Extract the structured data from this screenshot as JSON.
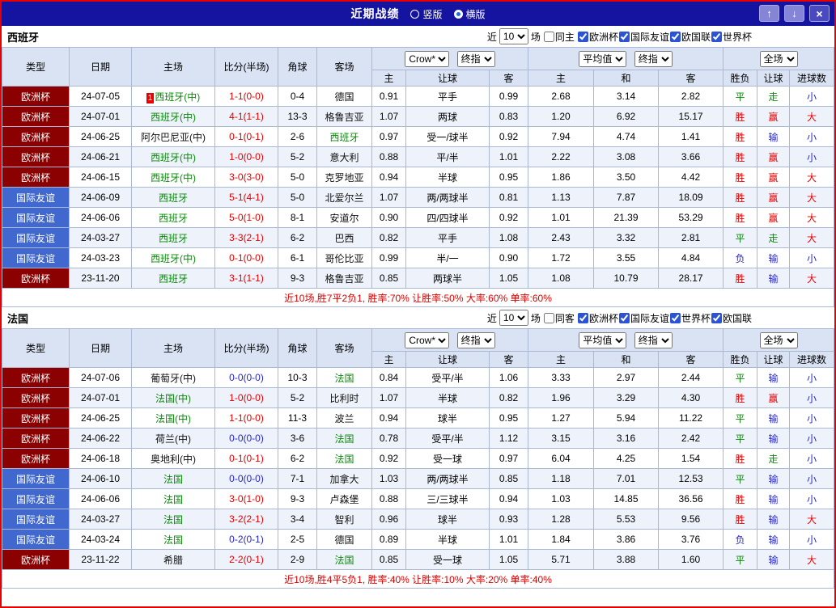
{
  "titlebar": {
    "title": "近期战绩",
    "layout_options": [
      {
        "label": "竖版",
        "selected": false
      },
      {
        "label": "横版",
        "selected": true
      }
    ],
    "buttons": {
      "up": "↑",
      "down": "↓",
      "close": "×"
    }
  },
  "colors": {
    "titlebar_bg": "#1414a0",
    "frame_border": "#e60000",
    "euro_cup_bg": "#8b0000",
    "friendly_bg": "#4168cf",
    "header_bg": "#d9e3f3",
    "win_red": "#e60000",
    "loss_blue": "#2626cc",
    "draw_green": "#0a8a0a"
  },
  "table_header": {
    "type": "类型",
    "date": "日期",
    "home": "主场",
    "score": "比分(半场)",
    "corner": "角球",
    "away": "客场",
    "asia_home": "主",
    "asia_handicap": "让球",
    "asia_away": "客",
    "euro_home": "主",
    "euro_draw": "和",
    "euro_away": "客",
    "result": "胜负",
    "result_handicap": "让球",
    "result_goals": "进球数"
  },
  "sections": [
    {
      "team": "西班牙",
      "filter": {
        "near": "近",
        "count": "10",
        "games": "场",
        "same": "同主",
        "competitions": [
          "欧洲杯",
          "国际友谊",
          "欧国联",
          "世界杯"
        ]
      },
      "selects": {
        "asia_company": "Crow*",
        "asia_time": "终指",
        "euro_company": "平均值",
        "euro_time": "终指",
        "scope": "全场"
      },
      "rows": [
        {
          "type": "欧洲杯",
          "tc": "cup",
          "date": "24-07-05",
          "rank": "1",
          "home": "西班牙(中)",
          "hc": "green",
          "score": "1-1(0-0)",
          "sc": "red",
          "corner": "0-4",
          "away": "德国",
          "ac": "black",
          "ah": "0.91",
          "hd": "平手",
          "aa": "0.99",
          "eh": "2.68",
          "ed": "3.14",
          "ea": "2.82",
          "r1": "平",
          "r1c": "green",
          "r2": "走",
          "r2c": "green",
          "r3": "小",
          "r3c": "blue"
        },
        {
          "type": "欧洲杯",
          "tc": "cup",
          "date": "24-07-01",
          "home": "西班牙(中)",
          "hc": "green",
          "score": "4-1(1-1)",
          "sc": "red",
          "corner": "13-3",
          "away": "格鲁吉亚",
          "ac": "black",
          "ah": "1.07",
          "hd": "两球",
          "aa": "0.83",
          "eh": "1.20",
          "ed": "6.92",
          "ea": "15.17",
          "r1": "胜",
          "r1c": "red",
          "r2": "赢",
          "r2c": "red",
          "r3": "大",
          "r3c": "red"
        },
        {
          "type": "欧洲杯",
          "tc": "cup",
          "date": "24-06-25",
          "home": "阿尔巴尼亚(中)",
          "hc": "black",
          "score": "0-1(0-1)",
          "sc": "red",
          "corner": "2-6",
          "away": "西班牙",
          "ac": "green",
          "ah": "0.97",
          "hd": "受一/球半",
          "aa": "0.92",
          "eh": "7.94",
          "ed": "4.74",
          "ea": "1.41",
          "r1": "胜",
          "r1c": "red",
          "r2": "输",
          "r2c": "blue",
          "r3": "小",
          "r3c": "blue"
        },
        {
          "type": "欧洲杯",
          "tc": "cup",
          "date": "24-06-21",
          "home": "西班牙(中)",
          "hc": "green",
          "score": "1-0(0-0)",
          "sc": "red",
          "corner": "5-2",
          "away": "意大利",
          "ac": "black",
          "ah": "0.88",
          "hd": "平/半",
          "aa": "1.01",
          "eh": "2.22",
          "ed": "3.08",
          "ea": "3.66",
          "r1": "胜",
          "r1c": "red",
          "r2": "赢",
          "r2c": "red",
          "r3": "小",
          "r3c": "blue"
        },
        {
          "type": "欧洲杯",
          "tc": "cup",
          "date": "24-06-15",
          "home": "西班牙(中)",
          "hc": "green",
          "score": "3-0(3-0)",
          "sc": "red",
          "corner": "5-0",
          "away": "克罗地亚",
          "ac": "black",
          "ah": "0.94",
          "hd": "半球",
          "aa": "0.95",
          "eh": "1.86",
          "ed": "3.50",
          "ea": "4.42",
          "r1": "胜",
          "r1c": "red",
          "r2": "赢",
          "r2c": "red",
          "r3": "大",
          "r3c": "red"
        },
        {
          "type": "国际友谊",
          "tc": "friendly",
          "date": "24-06-09",
          "home": "西班牙",
          "hc": "green",
          "score": "5-1(4-1)",
          "sc": "red",
          "corner": "5-0",
          "away": "北爱尔兰",
          "ac": "black",
          "ah": "1.07",
          "hd": "两/两球半",
          "aa": "0.81",
          "eh": "1.13",
          "ed": "7.87",
          "ea": "18.09",
          "r1": "胜",
          "r1c": "red",
          "r2": "赢",
          "r2c": "red",
          "r3": "大",
          "r3c": "red"
        },
        {
          "type": "国际友谊",
          "tc": "friendly",
          "date": "24-06-06",
          "home": "西班牙",
          "hc": "green",
          "score": "5-0(1-0)",
          "sc": "red",
          "corner": "8-1",
          "away": "安道尔",
          "ac": "black",
          "ah": "0.90",
          "hd": "四/四球半",
          "aa": "0.92",
          "eh": "1.01",
          "ed": "21.39",
          "ea": "53.29",
          "r1": "胜",
          "r1c": "red",
          "r2": "赢",
          "r2c": "red",
          "r3": "大",
          "r3c": "red"
        },
        {
          "type": "国际友谊",
          "tc": "friendly",
          "date": "24-03-27",
          "home": "西班牙",
          "hc": "green",
          "score": "3-3(2-1)",
          "sc": "red",
          "corner": "6-2",
          "away": "巴西",
          "ac": "black",
          "ah": "0.82",
          "hd": "平手",
          "aa": "1.08",
          "eh": "2.43",
          "ed": "3.32",
          "ea": "2.81",
          "r1": "平",
          "r1c": "green",
          "r2": "走",
          "r2c": "green",
          "r3": "大",
          "r3c": "red"
        },
        {
          "type": "国际友谊",
          "tc": "friendly",
          "date": "24-03-23",
          "home": "西班牙(中)",
          "hc": "green",
          "score": "0-1(0-0)",
          "sc": "red",
          "corner": "6-1",
          "away": "哥伦比亚",
          "ac": "black",
          "ah": "0.99",
          "hd": "半/一",
          "aa": "0.90",
          "eh": "1.72",
          "ed": "3.55",
          "ea": "4.84",
          "r1": "负",
          "r1c": "blue",
          "r2": "输",
          "r2c": "blue",
          "r3": "小",
          "r3c": "blue"
        },
        {
          "type": "欧洲杯",
          "tc": "cup",
          "date": "23-11-20",
          "home": "西班牙",
          "hc": "green",
          "score": "3-1(1-1)",
          "sc": "red",
          "corner": "9-3",
          "away": "格鲁吉亚",
          "ac": "black",
          "ah": "0.85",
          "hd": "两球半",
          "aa": "1.05",
          "eh": "1.08",
          "ed": "10.79",
          "ea": "28.17",
          "r1": "胜",
          "r1c": "red",
          "r2": "输",
          "r2c": "blue",
          "r3": "大",
          "r3c": "red"
        }
      ],
      "summary": "近10场,胜7平2负1, 胜率:70% 让胜率:50% 大率:60% 单率:60%"
    },
    {
      "team": "法国",
      "filter": {
        "near": "近",
        "count": "10",
        "games": "场",
        "same": "同客",
        "competitions": [
          "欧洲杯",
          "国际友谊",
          "世界杯",
          "欧国联"
        ]
      },
      "selects": {
        "asia_company": "Crow*",
        "asia_time": "终指",
        "euro_company": "平均值",
        "euro_time": "终指",
        "scope": "全场"
      },
      "rows": [
        {
          "type": "欧洲杯",
          "tc": "cup",
          "date": "24-07-06",
          "home": "葡萄牙(中)",
          "hc": "black",
          "score": "0-0(0-0)",
          "sc": "blue",
          "corner": "10-3",
          "away": "法国",
          "ac": "green",
          "ah": "0.84",
          "hd": "受平/半",
          "aa": "1.06",
          "eh": "3.33",
          "ed": "2.97",
          "ea": "2.44",
          "r1": "平",
          "r1c": "green",
          "r2": "输",
          "r2c": "blue",
          "r3": "小",
          "r3c": "blue"
        },
        {
          "type": "欧洲杯",
          "tc": "cup",
          "date": "24-07-01",
          "home": "法国(中)",
          "hc": "green",
          "score": "1-0(0-0)",
          "sc": "red",
          "corner": "5-2",
          "away": "比利时",
          "ac": "black",
          "ah": "1.07",
          "hd": "半球",
          "aa": "0.82",
          "eh": "1.96",
          "ed": "3.29",
          "ea": "4.30",
          "r1": "胜",
          "r1c": "red",
          "r2": "赢",
          "r2c": "red",
          "r3": "小",
          "r3c": "blue"
        },
        {
          "type": "欧洲杯",
          "tc": "cup",
          "date": "24-06-25",
          "home": "法国(中)",
          "hc": "green",
          "score": "1-1(0-0)",
          "sc": "red",
          "corner": "11-3",
          "away": "波兰",
          "ac": "black",
          "ah": "0.94",
          "hd": "球半",
          "aa": "0.95",
          "eh": "1.27",
          "ed": "5.94",
          "ea": "11.22",
          "r1": "平",
          "r1c": "green",
          "r2": "输",
          "r2c": "blue",
          "r3": "小",
          "r3c": "blue"
        },
        {
          "type": "欧洲杯",
          "tc": "cup",
          "date": "24-06-22",
          "home": "荷兰(中)",
          "hc": "black",
          "score": "0-0(0-0)",
          "sc": "blue",
          "corner": "3-6",
          "away": "法国",
          "ac": "green",
          "ah": "0.78",
          "hd": "受平/半",
          "aa": "1.12",
          "eh": "3.15",
          "ed": "3.16",
          "ea": "2.42",
          "r1": "平",
          "r1c": "green",
          "r2": "输",
          "r2c": "blue",
          "r3": "小",
          "r3c": "blue"
        },
        {
          "type": "欧洲杯",
          "tc": "cup",
          "date": "24-06-18",
          "home": "奥地利(中)",
          "hc": "black",
          "score": "0-1(0-1)",
          "sc": "red",
          "corner": "6-2",
          "away": "法国",
          "ac": "green",
          "ah": "0.92",
          "hd": "受一球",
          "aa": "0.97",
          "eh": "6.04",
          "ed": "4.25",
          "ea": "1.54",
          "r1": "胜",
          "r1c": "red",
          "r2": "走",
          "r2c": "green",
          "r3": "小",
          "r3c": "blue"
        },
        {
          "type": "国际友谊",
          "tc": "friendly",
          "date": "24-06-10",
          "home": "法国",
          "hc": "green",
          "score": "0-0(0-0)",
          "sc": "blue",
          "corner": "7-1",
          "away": "加拿大",
          "ac": "black",
          "ah": "1.03",
          "hd": "两/两球半",
          "aa": "0.85",
          "eh": "1.18",
          "ed": "7.01",
          "ea": "12.53",
          "r1": "平",
          "r1c": "green",
          "r2": "输",
          "r2c": "blue",
          "r3": "小",
          "r3c": "blue"
        },
        {
          "type": "国际友谊",
          "tc": "friendly",
          "date": "24-06-06",
          "home": "法国",
          "hc": "green",
          "score": "3-0(1-0)",
          "sc": "red",
          "corner": "9-3",
          "away": "卢森堡",
          "ac": "black",
          "ah": "0.88",
          "hd": "三/三球半",
          "aa": "0.94",
          "eh": "1.03",
          "ed": "14.85",
          "ea": "36.56",
          "r1": "胜",
          "r1c": "red",
          "r2": "输",
          "r2c": "blue",
          "r3": "小",
          "r3c": "blue"
        },
        {
          "type": "国际友谊",
          "tc": "friendly",
          "date": "24-03-27",
          "home": "法国",
          "hc": "green",
          "score": "3-2(2-1)",
          "sc": "red",
          "corner": "3-4",
          "away": "智利",
          "ac": "black",
          "ah": "0.96",
          "hd": "球半",
          "aa": "0.93",
          "eh": "1.28",
          "ed": "5.53",
          "ea": "9.56",
          "r1": "胜",
          "r1c": "red",
          "r2": "输",
          "r2c": "blue",
          "r3": "大",
          "r3c": "red"
        },
        {
          "type": "国际友谊",
          "tc": "friendly",
          "date": "24-03-24",
          "home": "法国",
          "hc": "green",
          "score": "0-2(0-1)",
          "sc": "blue",
          "corner": "2-5",
          "away": "德国",
          "ac": "black",
          "ah": "0.89",
          "hd": "半球",
          "aa": "1.01",
          "eh": "1.84",
          "ed": "3.86",
          "ea": "3.76",
          "r1": "负",
          "r1c": "blue",
          "r2": "输",
          "r2c": "blue",
          "r3": "小",
          "r3c": "blue"
        },
        {
          "type": "欧洲杯",
          "tc": "cup",
          "date": "23-11-22",
          "home": "希腊",
          "hc": "black",
          "score": "2-2(0-1)",
          "sc": "red",
          "corner": "2-9",
          "away": "法国",
          "ac": "green",
          "ah": "0.85",
          "hd": "受一球",
          "aa": "1.05",
          "eh": "5.71",
          "ed": "3.88",
          "ea": "1.60",
          "r1": "平",
          "r1c": "green",
          "r2": "输",
          "r2c": "blue",
          "r3": "大",
          "r3c": "red"
        }
      ],
      "summary": "近10场,胜4平5负1, 胜率:40% 让胜率:10% 大率:20% 单率:40%"
    }
  ]
}
